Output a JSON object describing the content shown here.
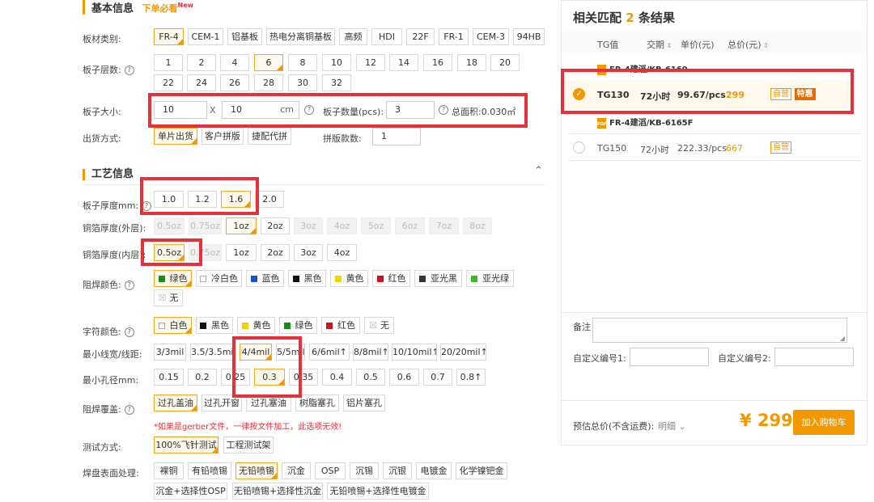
{
  "basic": {
    "title": "基本信息",
    "must_note": "下单必看",
    "new_badge": "New",
    "board_type_label": "板材类别:",
    "board_types": [
      "FR-4",
      "CEM-1",
      "铝基板",
      "热电分离铜基板",
      "高频",
      "HDI",
      "22F",
      "FR-1",
      "CEM-3",
      "94HB"
    ],
    "layers_label": "板子层数:",
    "layers": [
      "1",
      "2",
      "4",
      "6",
      "8",
      "10",
      "12",
      "14",
      "16",
      "18",
      "20",
      "22",
      "24",
      "26",
      "28",
      "30",
      "32"
    ],
    "size_label": "板子大小:",
    "size_w": "10",
    "size_x": "X",
    "size_h": "10",
    "size_unit": "cm",
    "qty_label": "板子数量(pcs):",
    "qty": "3",
    "area": "总面积:0.030㎡",
    "ship_label": "出货方式:",
    "ship_opts": [
      "单片出货",
      "客户拼版",
      "捷配代拼"
    ],
    "panel_count_label": "拼版款数:",
    "panel_count": "1"
  },
  "process": {
    "title": "工艺信息",
    "thickness_label": "板子厚度mm:",
    "thickness": [
      "1.0",
      "1.2",
      "1.6",
      "2.0"
    ],
    "outer_cu_label": "铜箔厚度(外层):",
    "outer_cu": [
      "0.5oz",
      "0.75oz",
      "1oz",
      "2oz",
      "3oz",
      "4oz",
      "5oz",
      "6oz",
      "7oz",
      "8oz"
    ],
    "inner_cu_label": "铜箔厚度(内层):",
    "inner_cu": [
      "0.5oz",
      "0.75oz",
      "1oz",
      "2oz",
      "3oz",
      "4oz"
    ],
    "mask_label": "阻焊颜色:",
    "mask_colors": [
      "绿色",
      "冷白色",
      "蓝色",
      "黑色",
      "黄色",
      "红色",
      "亚光黑",
      "亚光绿",
      "无"
    ],
    "silk_label": "字符颜色:",
    "silk_colors": [
      "白色",
      "黑色",
      "黄色",
      "绿色",
      "红色",
      "无"
    ],
    "trace_label": "最小线宽/线距:",
    "trace": [
      "3/3mil",
      "3.5/3.5mil",
      "4/4mil",
      "5/5mil",
      "6/6mil↑",
      "8/8mil↑",
      "10/10mil↑",
      "20/20mil↑"
    ],
    "hole_label": "最小孔径mm:",
    "hole": [
      "0.15",
      "0.2",
      "0.25",
      "0.3",
      "0.35",
      "0.4",
      "0.5",
      "0.6",
      "0.7",
      "0.8↑"
    ],
    "via_label": "阻焊覆盖:",
    "via": [
      "过孔盖油",
      "过孔开窗",
      "过孔塞油",
      "树脂塞孔",
      "铝片塞孔"
    ],
    "via_note": "*如果是gerber文件，一律按文件加工，此选项无效!",
    "test_label": "测试方式:",
    "test": [
      "100%飞针测试",
      "工程测试架"
    ],
    "finish_label": "焊盘表面处理:",
    "finish": [
      "裸铜",
      "有铅喷锡",
      "无铅喷锡",
      "沉金",
      "OSP",
      "沉锡",
      "沉银",
      "电镀金",
      "化学镍钯金",
      "沉金+选择性OSP",
      "无铅喷锡+选择性沉金",
      "无铅喷锡+选择性电镀金"
    ]
  },
  "panel": {
    "title_pre": "相关匹配",
    "count": "2",
    "title_post": "条结果",
    "col_tg": "TG值",
    "col_lead": "交期",
    "col_unit": "单价(元)",
    "col_total": "总价(元)",
    "r1_material": "FR-4建滔/KB-6160",
    "r1_tg": "TG130",
    "r1_lead": "72小时",
    "r1_unit": "99.67/pcs",
    "r1_total": "299",
    "r1_tag1": "自营",
    "r1_tag2": "特惠",
    "r2_material": "FR-4建滔/KB-6165F",
    "r2_tg": "TG150",
    "r2_lead": "72小时",
    "r2_unit": "222.33/pcs",
    "r2_total": "667",
    "r2_tag1": "自营",
    "remark_label": "备注",
    "code1_label": "自定义编号1:",
    "code2_label": "自定义编号2:",
    "est_label": "预估总价(不含运费):",
    "detail_label": "明细",
    "currency": "¥",
    "price": "299",
    "cart_button": "加入购物车",
    "accent": "#f39800"
  },
  "icons": {
    "help": "question-circle-icon",
    "collapse": "chevron-up-icon",
    "check": "check-circle-icon",
    "pdf": "pdf-icon",
    "chevron": "chevron-down-icon"
  },
  "colors": {
    "green": "#1a8a1a",
    "blue": "#1f4fd1",
    "black": "#111111",
    "yellow": "#f7d000",
    "red": "#c8161d",
    "matte_black": "#333333",
    "matte_green": "#3dbb2e",
    "highlight": "#e8303a"
  }
}
